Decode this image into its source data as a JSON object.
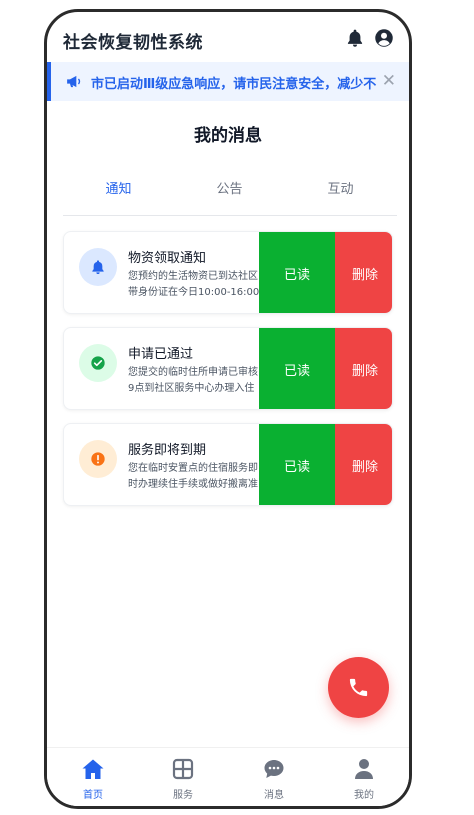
{
  "header": {
    "title": "社会恢复韧性系统",
    "icons": [
      "bell-icon",
      "user-circle-icon"
    ]
  },
  "notice": {
    "text": "市已启动Ⅲ级应急响应，请市民注意安全，减少不",
    "icon": "megaphone-icon",
    "close_label": "✕"
  },
  "page": {
    "title": "我的消息"
  },
  "tabs": [
    {
      "label": "通知",
      "active": true
    },
    {
      "label": "公告",
      "active": false
    },
    {
      "label": "互动",
      "active": false
    }
  ],
  "messages": [
    {
      "title": "物资领取通知",
      "line1": "您预约的生活物资已到达社区",
      "line2": "带身份证在今日10:00-16:00",
      "icon": "bell-icon",
      "icon_color": "#2563eb",
      "icon_bg": "#dbe8ff"
    },
    {
      "title": "申请已通过",
      "line1": "您提交的临时住所申请已审核",
      "line2": "9点到社区服务中心办理入住",
      "icon": "check-circle-icon",
      "icon_color": "#16a34a",
      "icon_bg": "#dcfce7"
    },
    {
      "title": "服务即将到期",
      "line1": "您在临时安置点的住宿服务即",
      "line2": "时办理续住手续或做好搬离准",
      "icon": "warning-circle-icon",
      "icon_color": "#f97316",
      "icon_bg": "#ffedd5"
    }
  ],
  "actions": {
    "read_label": "已读",
    "delete_label": "删除"
  },
  "fab": {
    "icon": "phone-icon",
    "color": "#ef4444"
  },
  "bottom_nav": [
    {
      "label": "首页",
      "icon": "home-icon",
      "active": true
    },
    {
      "label": "服务",
      "icon": "grid-icon",
      "active": false
    },
    {
      "label": "消息",
      "icon": "chat-icon",
      "active": false
    },
    {
      "label": "我的",
      "icon": "person-icon",
      "active": false
    }
  ],
  "colors": {
    "accent": "#2563eb",
    "read": "#0ab031",
    "delete": "#ef4444"
  }
}
